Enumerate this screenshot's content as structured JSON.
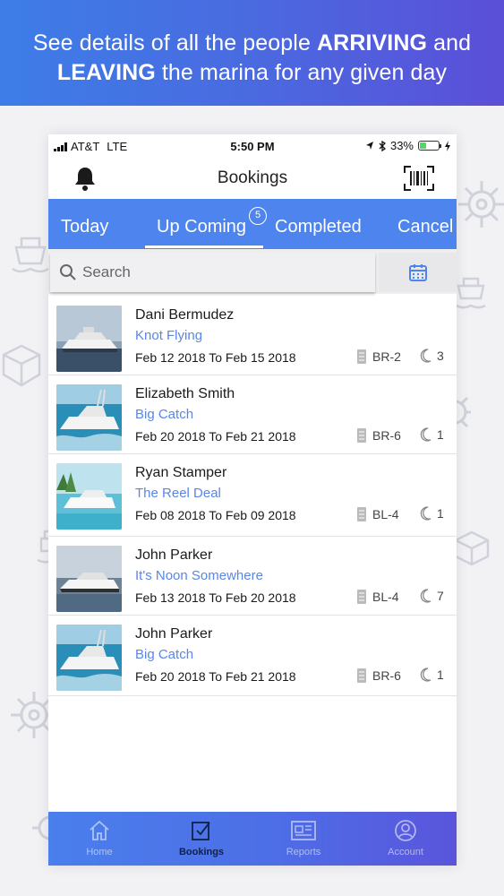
{
  "banner": {
    "line1_pre": "See details of all the people ",
    "line1_bold": "ARRIVING",
    "line1_post": " and",
    "line2_bold": "LEAVING",
    "line2_post": " the marina for any given day"
  },
  "status_bar": {
    "carrier": "AT&T",
    "network": "LTE",
    "time": "5:50 PM",
    "battery": "33%"
  },
  "header": {
    "title": "Bookings"
  },
  "tabs": [
    {
      "label": "Today"
    },
    {
      "label": "Up Coming",
      "badge": "5",
      "active": true
    },
    {
      "label": "Completed"
    },
    {
      "label": "Cancel"
    }
  ],
  "search": {
    "placeholder": "Search"
  },
  "bookings": [
    {
      "name": "Dani Bermudez",
      "boat": "Knot Flying",
      "dates": "Feb 12 2018 To Feb 15 2018",
      "berth": "BR-2",
      "nights": "3"
    },
    {
      "name": "Elizabeth Smith",
      "boat": "Big Catch",
      "dates": "Feb 20 2018 To Feb 21 2018",
      "berth": "BR-6",
      "nights": "1"
    },
    {
      "name": "Ryan Stamper",
      "boat": "The Reel Deal",
      "dates": "Feb 08 2018 To Feb 09 2018",
      "berth": "BL-4",
      "nights": "1"
    },
    {
      "name": "John Parker",
      "boat": "It's Noon Somewhere",
      "dates": "Feb 13 2018 To Feb 20 2018",
      "berth": "BL-4",
      "nights": "7"
    },
    {
      "name": "John Parker",
      "boat": "Big Catch",
      "dates": "Feb 20 2018 To Feb 21 2018",
      "berth": "BR-6",
      "nights": "1"
    }
  ],
  "tabbar": [
    {
      "label": "Home",
      "icon": "home-icon"
    },
    {
      "label": "Bookings",
      "icon": "bookings-icon",
      "active": true
    },
    {
      "label": "Reports",
      "icon": "reports-icon"
    },
    {
      "label": "Account",
      "icon": "account-icon"
    }
  ],
  "colors": {
    "accent": "#4d84ee",
    "boat_name": "#5a86e6",
    "banner_start": "#3d7de8",
    "banner_end": "#5b4fd8"
  }
}
